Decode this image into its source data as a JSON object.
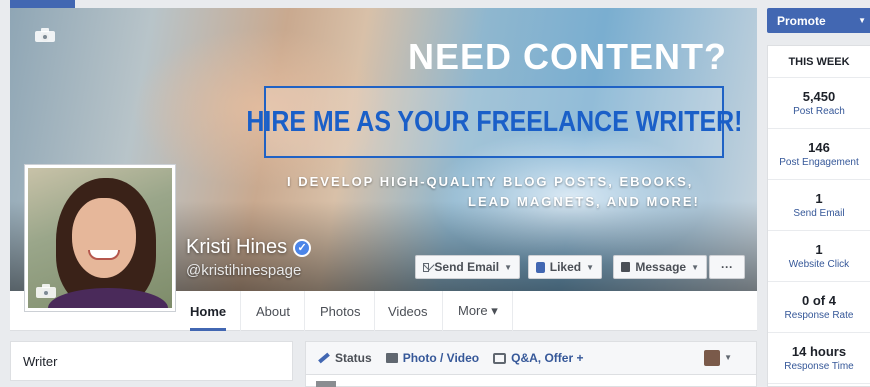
{
  "cover": {
    "headline": "NEED CONTENT?",
    "banner": "HIRE ME AS YOUR FREELANCE WRITER!",
    "line1": "I DEVELOP HIGH-QUALITY BLOG POSTS, EBOOKS,",
    "line2": "LEAD MAGNETS, AND MORE!",
    "colors": {
      "banner_text": "#1a5fc8",
      "banner_border": "#1f62c5"
    }
  },
  "profile": {
    "name": "Kristi Hines",
    "handle": "@kristihinespage",
    "verified_icon": "verified-check-icon"
  },
  "actions": {
    "send_email": "Send Email",
    "liked": "Liked",
    "message": "Message",
    "more": "···"
  },
  "tabs": [
    {
      "label": "Home",
      "active": true
    },
    {
      "label": "About"
    },
    {
      "label": "Photos"
    },
    {
      "label": "Videos"
    },
    {
      "label": "More ▾"
    }
  ],
  "intro": {
    "category": "Writer"
  },
  "composer": {
    "status": "Status",
    "photo_video": "Photo / Video",
    "qa_offer": "Q&A, Offer +"
  },
  "sidebar": {
    "promote": "Promote",
    "week_title": "THIS WEEK",
    "stats": [
      {
        "value": "5,450",
        "label": "Post Reach"
      },
      {
        "value": "146",
        "label": "Post Engagement"
      },
      {
        "value": "1",
        "label": "Send Email"
      },
      {
        "value": "1",
        "label": "Website Click"
      },
      {
        "value": "0 of 4",
        "label": "Response Rate"
      },
      {
        "value": "14 hours",
        "label": "Response Time"
      }
    ],
    "accent": "#4267b2"
  }
}
